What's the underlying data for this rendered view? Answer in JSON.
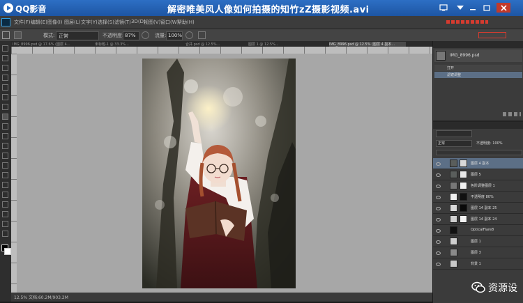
{
  "player": {
    "app_name": "QQ影音",
    "video_title": "解密唯美风人像如何拍摄的知竹zZ摄影视频.avi"
  },
  "photoshop": {
    "menu": [
      "文件(F)",
      "编辑(E)",
      "图像(I)",
      "图层(L)",
      "文字(Y)",
      "选择(S)",
      "滤镜(T)",
      "3D(D)",
      "视图(V)",
      "窗口(W)",
      "帮助(H)"
    ],
    "options": {
      "mode_label": "模式:",
      "mode_value": "正常",
      "opacity_label": "不透明度:",
      "opacity_value": "87%",
      "flow_label": "流量:",
      "flow_value": "100%"
    },
    "tabs": [
      "IMG_8996.psd @ 17.6% (图层 4...",
      "未标题-1 @ 33.3%...",
      "合并.psd @ 12.5%...",
      "图层 1 @ 12.5%...",
      "IMG_8996.psd @ 12.5% (图层 4 副本..."
    ],
    "status_text": "12.5%  文档:60.2M/903.2M"
  },
  "history": {
    "items": [
      "IMG_8996.psd",
      "打开",
      "滤镜调整"
    ]
  },
  "layers": {
    "blend_mode": "正常",
    "opacity": "不透明度: 100%",
    "items": [
      "图层 4 副本",
      "图层 5",
      "色阶调整图层 1",
      "不透明度 80%",
      "图层 14 副本 25",
      "图层 14 副本 24",
      "OpticalFlare8",
      "图层 1",
      "图层 3",
      "背景 1"
    ]
  },
  "watermark": {
    "text": "资源设"
  }
}
